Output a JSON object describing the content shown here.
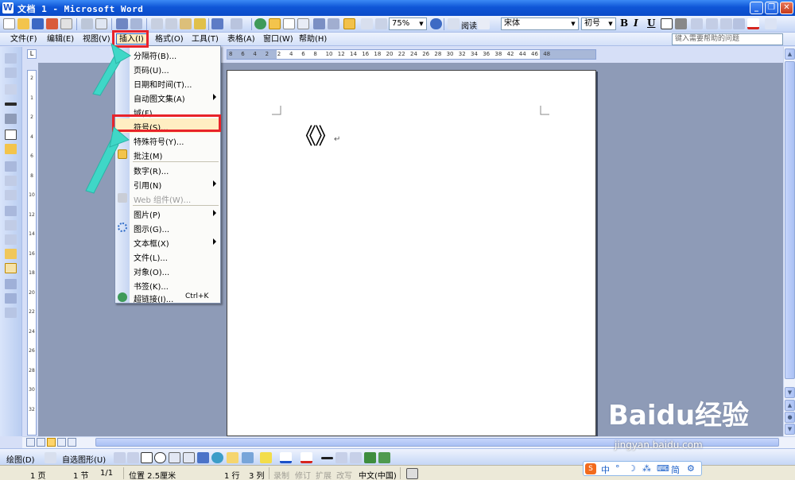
{
  "window": {
    "title": "文档 1 - Microsoft Word",
    "app_icon": "W",
    "minimize": "_",
    "maximize": "❐",
    "close": "✕"
  },
  "toolbar1": {
    "zoom": "75%",
    "read_label": "阅读",
    "font_name": "宋体",
    "font_size": "初号",
    "bold": "B",
    "italic": "I",
    "underline": "U"
  },
  "menubar": {
    "items": [
      {
        "label": "文件(F)"
      },
      {
        "label": "编辑(E)"
      },
      {
        "label": "视图(V)"
      },
      {
        "label": "插入(I)"
      },
      {
        "label": "格式(O)"
      },
      {
        "label": "工具(T)"
      },
      {
        "label": "表格(A)"
      },
      {
        "label": "窗口(W)"
      },
      {
        "label": "帮助(H)"
      }
    ],
    "help_placeholder": "键入需要帮助的问题"
  },
  "insert_menu": {
    "items": [
      {
        "label": "分隔符(B)...",
        "icon": "none"
      },
      {
        "label": "页码(U)...",
        "icon": "none"
      },
      {
        "label": "日期和时间(T)...",
        "icon": "none"
      },
      {
        "label": "自动图文集(A)",
        "icon": "none",
        "submenu": true
      },
      {
        "label": "域(F)...",
        "icon": "none"
      },
      {
        "label": "符号(S)...",
        "icon": "none",
        "highlight": true
      },
      {
        "label": "特殊符号(Y)...",
        "icon": "omega-icon"
      },
      {
        "label": "批注(M)",
        "icon": "comment-folder-icon"
      },
      {
        "label": "数字(R)...",
        "icon": "none"
      },
      {
        "label": "引用(N)",
        "icon": "none",
        "submenu": true
      },
      {
        "label": "Web 组件(W)...",
        "icon": "web-component-icon",
        "disabled": true
      },
      {
        "label": "图片(P)",
        "icon": "none",
        "submenu": true
      },
      {
        "label": "图示(G)...",
        "icon": "diagram-icon"
      },
      {
        "label": "文本框(X)",
        "icon": "none",
        "submenu": true
      },
      {
        "label": "文件(L)...",
        "icon": "none"
      },
      {
        "label": "对象(O)...",
        "icon": "none"
      },
      {
        "label": "书签(K)...",
        "icon": "none"
      },
      {
        "label": "超链接(I)...",
        "icon": "hyperlink-globe-icon",
        "shortcut": "Ctrl+K"
      }
    ]
  },
  "document": {
    "text": "《》",
    "para_mark": "↵"
  },
  "ruler": {
    "h_numbers": [
      "8",
      "6",
      "4",
      "2",
      "2",
      "4",
      "6",
      "8",
      "10",
      "12",
      "14",
      "16",
      "18",
      "20",
      "22",
      "24",
      "26",
      "28",
      "30",
      "32",
      "34",
      "36",
      "38",
      "42",
      "44",
      "46",
      "48"
    ],
    "v_numbers": [
      "2",
      "1",
      "2",
      "4",
      "6",
      "8",
      "10",
      "12",
      "14",
      "16",
      "18",
      "20",
      "22",
      "24",
      "26",
      "28",
      "30",
      "32"
    ],
    "corner": "L"
  },
  "drawbar": {
    "draw_label": "绘图(D)",
    "autoshape_label": "自选图形(U)"
  },
  "statusbar": {
    "page": "1 页",
    "section": "1 节",
    "pages": "1/1",
    "position": "位置 2.5厘米",
    "line": "1 行",
    "col": "3 列",
    "rec": "录制",
    "trk": "修订",
    "ext": "扩展",
    "ovr": "改写",
    "lang": "中文(中国)"
  },
  "ime": {
    "logo": "S",
    "chars": [
      "中",
      "°",
      "☽",
      "⁂",
      "⌨",
      "简",
      "⚙"
    ]
  },
  "watermark": {
    "brand": "Baidu经验",
    "url": "jingyan.baidu.com"
  },
  "colors": {
    "title_bar": "#0f56d7",
    "menu_highlight": "#ffeec2",
    "red_annotation": "#e8232a",
    "cyan_arrow": "#3fd7c7",
    "doc_background": "#8e9bb7"
  }
}
